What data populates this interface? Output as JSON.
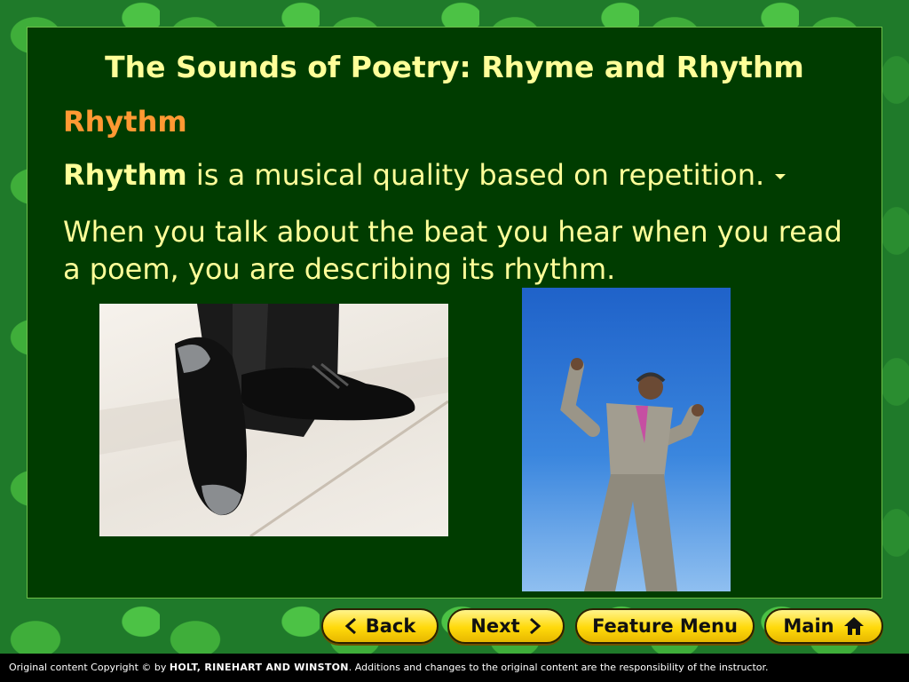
{
  "slide": {
    "title": "The Sounds of Poetry: Rhyme and Rhythm",
    "subhead": "Rhythm",
    "definition_term": "Rhythm",
    "definition_rest": " is a musical quality based on repetition.",
    "paragraph": "When you talk about the beat you hear when you read a poem, you are describing its rhythm."
  },
  "images": {
    "left": "tap-shoes-photo",
    "right": "dancing-man-photo"
  },
  "nav": {
    "back_label": "Back",
    "next_label": "Next",
    "feature_menu_label": "Feature Menu",
    "main_label": "Main"
  },
  "footer": {
    "prefix": "Original content Copyright © by ",
    "publisher": "HOLT, RINEHART AND WINSTON",
    "suffix": ". Additions and changes to the original content are the responsibility of the instructor."
  },
  "colors": {
    "panel": "#003c00",
    "title": "#ffff99",
    "subhead": "#ff9933",
    "button": "#ffd90a"
  }
}
